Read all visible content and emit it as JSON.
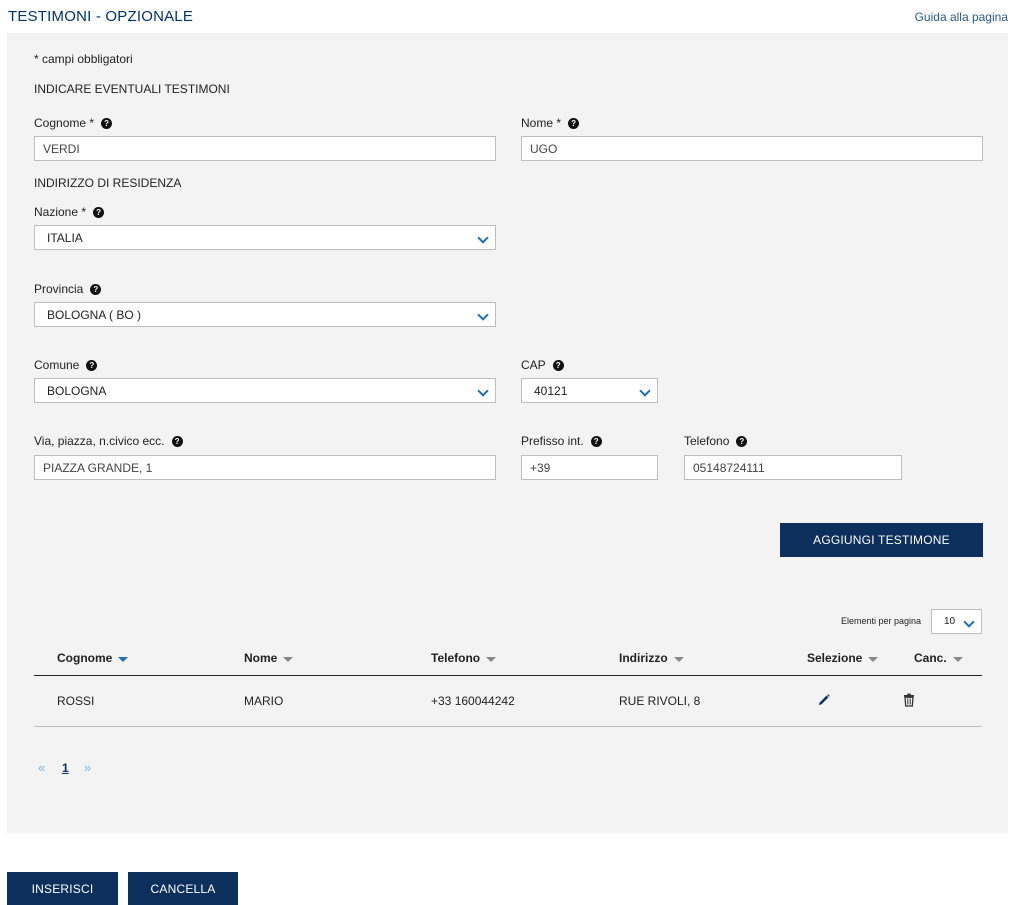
{
  "header": {
    "title": "TESTIMONI - OPZIONALE",
    "help_link": "Guida alla pagina"
  },
  "form": {
    "required_note": "*  campi obbligatori",
    "section_title": "INDICARE EVENTUALI TESTIMONI",
    "cognome": {
      "label": "Cognome *",
      "value": "VERDI"
    },
    "nome": {
      "label": "Nome *",
      "value": "UGO"
    },
    "address_title": "INDIRIZZO DI RESIDENZA",
    "nazione": {
      "label": "Nazione *",
      "value": "ITALIA"
    },
    "provincia": {
      "label": "Provincia",
      "value": "BOLOGNA ( BO )"
    },
    "comune": {
      "label": "Comune",
      "value": "BOLOGNA"
    },
    "cap": {
      "label": "CAP",
      "value": "40121"
    },
    "via": {
      "label": "Via, piazza, n.civico ecc.",
      "value": "PIAZZA GRANDE, 1"
    },
    "prefisso": {
      "label": "Prefisso int.",
      "value": "+39"
    },
    "telefono": {
      "label": "Telefono",
      "value": "05148724111"
    },
    "add_button": "AGGIUNGI TESTIMONE"
  },
  "table": {
    "per_page_label": "Elementi per pagina",
    "per_page_value": "10",
    "columns": [
      "Cognome",
      "Nome",
      "Telefono",
      "Indirizzo",
      "Selezione",
      "Canc."
    ],
    "rows": [
      {
        "cognome": "ROSSI",
        "nome": "MARIO",
        "telefono": "+33 160044242",
        "indirizzo": "RUE RIVOLI, 8"
      }
    ],
    "pagination": {
      "prev": "«",
      "current": "1",
      "next": "»"
    }
  },
  "footer": {
    "insert_button": "INSERISCI",
    "cancel_button": "CANCELLA"
  },
  "icons": {
    "help": "question-circle-icon",
    "edit": "pencil-icon",
    "delete": "trash-icon",
    "chevron": "chevron-down-icon",
    "sort": "sort-caret-icon"
  },
  "colors": {
    "primary": "#0c2f5c",
    "link": "#1f6fb5",
    "panel": "#f3f3f3"
  }
}
